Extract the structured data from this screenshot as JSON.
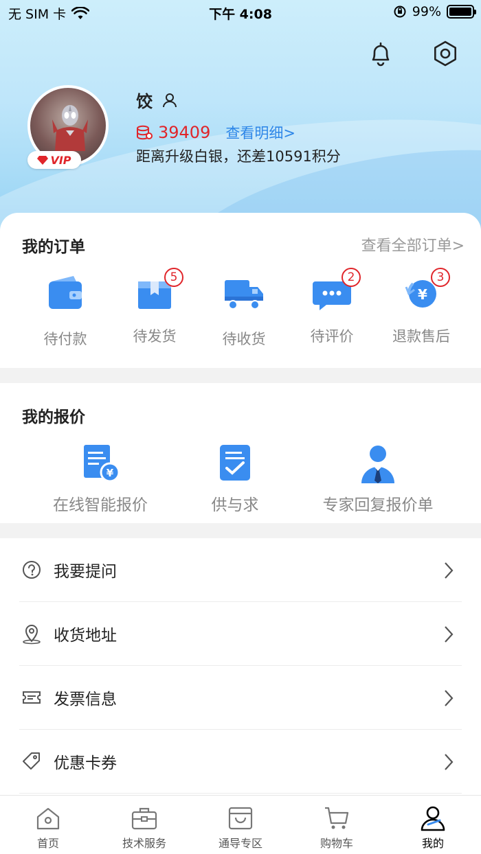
{
  "status_bar": {
    "carrier": "无 SIM 卡",
    "time": "下午 4:08",
    "battery": "99%"
  },
  "user": {
    "name": "饺",
    "vip_label": "VIP",
    "points": "39409",
    "points_link": "查看明细>",
    "level_note": "距离升级白银，还差10591积分"
  },
  "orders": {
    "title": "我的订单",
    "view_all": "查看全部订单>",
    "items": [
      {
        "label": "待付款",
        "badge": ""
      },
      {
        "label": "待发货",
        "badge": "5"
      },
      {
        "label": "待收货",
        "badge": ""
      },
      {
        "label": "待评价",
        "badge": "2"
      },
      {
        "label": "退款售后",
        "badge": "3"
      }
    ]
  },
  "quotes": {
    "title": "我的报价",
    "items": [
      {
        "label": "在线智能报价"
      },
      {
        "label": "供与求"
      },
      {
        "label": "专家回复报价单"
      }
    ]
  },
  "menu": [
    {
      "label": "我要提问",
      "icon": "question-icon"
    },
    {
      "label": "收货地址",
      "icon": "location-icon"
    },
    {
      "label": "发票信息",
      "icon": "ticket-icon"
    },
    {
      "label": "优惠卡券",
      "icon": "tag-icon"
    }
  ],
  "tabs": [
    {
      "label": "首页",
      "icon": "home-icon"
    },
    {
      "label": "技术服务",
      "icon": "toolbox-icon"
    },
    {
      "label": "通导专区",
      "icon": "shopping-bag-icon"
    },
    {
      "label": "购物车",
      "icon": "cart-icon"
    },
    {
      "label": "我的",
      "icon": "person-icon",
      "active": true
    }
  ],
  "colors": {
    "accent_blue": "#2d86e8",
    "accent_red": "#e0252a",
    "icon_blue": "#3a8df0"
  }
}
